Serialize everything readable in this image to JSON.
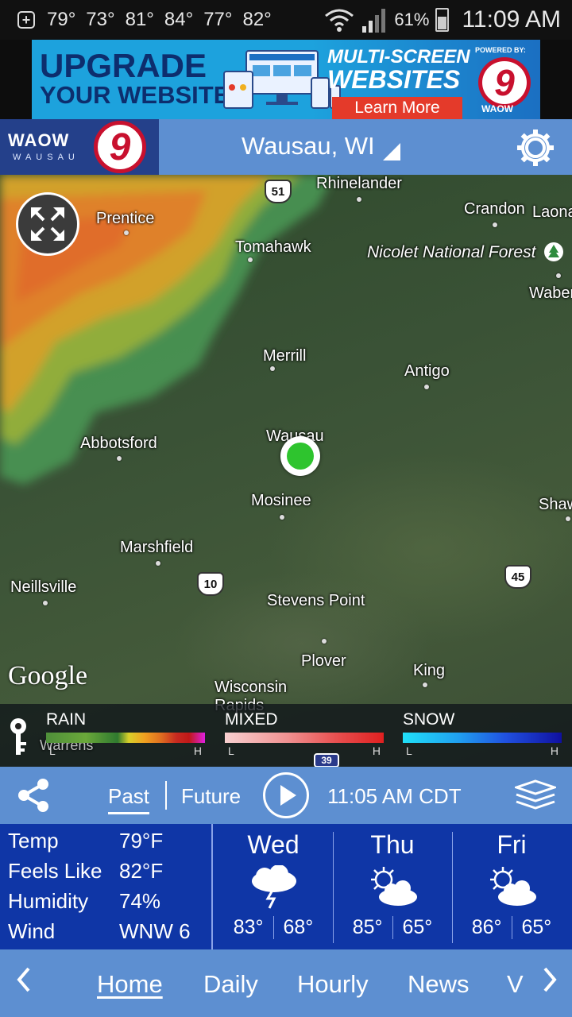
{
  "status_bar": {
    "temps": [
      "79°",
      "73°",
      "81°",
      "84°",
      "77°",
      "82°"
    ],
    "battery": "61%",
    "time": "11:09 AM"
  },
  "ad": {
    "line1": "UPGRADE",
    "line2": "YOUR WEBSITE",
    "multi1": "MULTI-SCREEN",
    "multi2": "WEBSITES",
    "cta": "Learn More",
    "powered": "POWERED BY:",
    "logo_number": "9",
    "logo_text": "WAOW"
  },
  "header": {
    "brand": "WAOW",
    "brand_city": "WAUSAU",
    "brand_number": "9",
    "location": "Wausau, WI"
  },
  "map": {
    "labels": {
      "rhinelander": "Rhinelander",
      "crandon": "Crandon",
      "laona": "Laona",
      "prentice": "Prentice",
      "tomahawk": "Tomahawk",
      "nicolet": "Nicolet National Forest",
      "waber": "Waber",
      "merrill": "Merrill",
      "antigo": "Antigo",
      "abbotsford": "Abbotsford",
      "wausau": "Wausau",
      "mosinee": "Mosinee",
      "shaw": "Shaw",
      "marshfield": "Marshfield",
      "neillsville": "Neillsville",
      "stevens_point": "Stevens Point",
      "plover": "Plover",
      "king": "King",
      "wisconsin_rapids": "Wisconsin Rapids",
      "warrens": "Warrens"
    },
    "shields": {
      "us51": "51",
      "us10": "10",
      "us45": "45",
      "i39": "39"
    },
    "attribution": "Google"
  },
  "legend": {
    "rain": {
      "title": "RAIN",
      "low": "L",
      "high": "H"
    },
    "mixed": {
      "title": "MIXED",
      "low": "L",
      "high": "H"
    },
    "snow": {
      "title": "SNOW",
      "low": "L",
      "high": "H"
    }
  },
  "controls": {
    "past": "Past",
    "future": "Future",
    "time": "11:05 AM CDT"
  },
  "current": {
    "temp_label": "Temp",
    "temp": "79°F",
    "feels_label": "Feels Like",
    "feels": "82°F",
    "humidity_label": "Humidity",
    "humidity": "74%",
    "wind_label": "Wind",
    "wind": "WNW 6"
  },
  "forecast": [
    {
      "day": "Wed",
      "icon": "thunderstorm-icon",
      "hi": "83°",
      "lo": "68°"
    },
    {
      "day": "Thu",
      "icon": "partly-sunny-icon",
      "hi": "85°",
      "lo": "65°"
    },
    {
      "day": "Fri",
      "icon": "partly-sunny-icon",
      "hi": "86°",
      "lo": "65°"
    }
  ],
  "nav": {
    "items": [
      "Home",
      "Daily",
      "Hourly",
      "News",
      "V"
    ]
  },
  "colors": {
    "header_blue": "#5d8fd1",
    "panel_blue": "#0f36a6",
    "location_dot": "#2ec42e"
  }
}
